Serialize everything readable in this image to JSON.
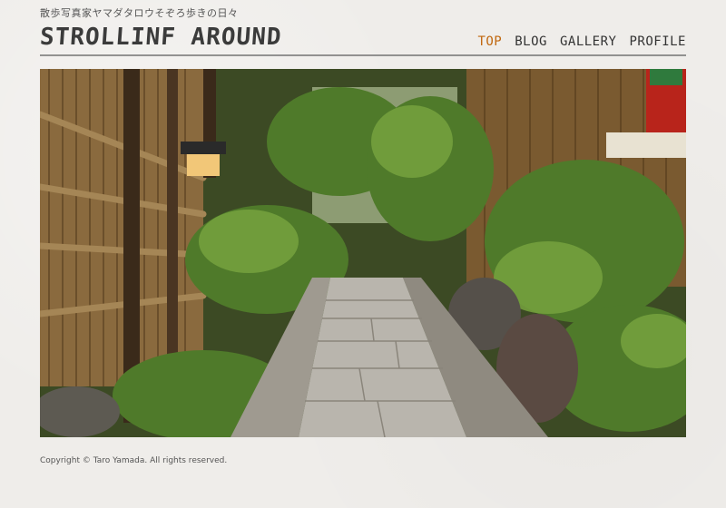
{
  "site": {
    "tagline": "散歩写真家ヤマダタロウそぞろ歩きの日々",
    "logo": "STROLLINF AROUND"
  },
  "nav": {
    "items": [
      "TOP",
      "BLOG",
      "GALLERY",
      "PROFILE"
    ],
    "active": "TOP",
    "active_color": "#c0670e"
  },
  "hero": {
    "alt": "Stone path through a bamboo-fenced garden alley"
  },
  "footer": {
    "copyright": "Copyright © Taro Yamada. All rights reserved."
  }
}
